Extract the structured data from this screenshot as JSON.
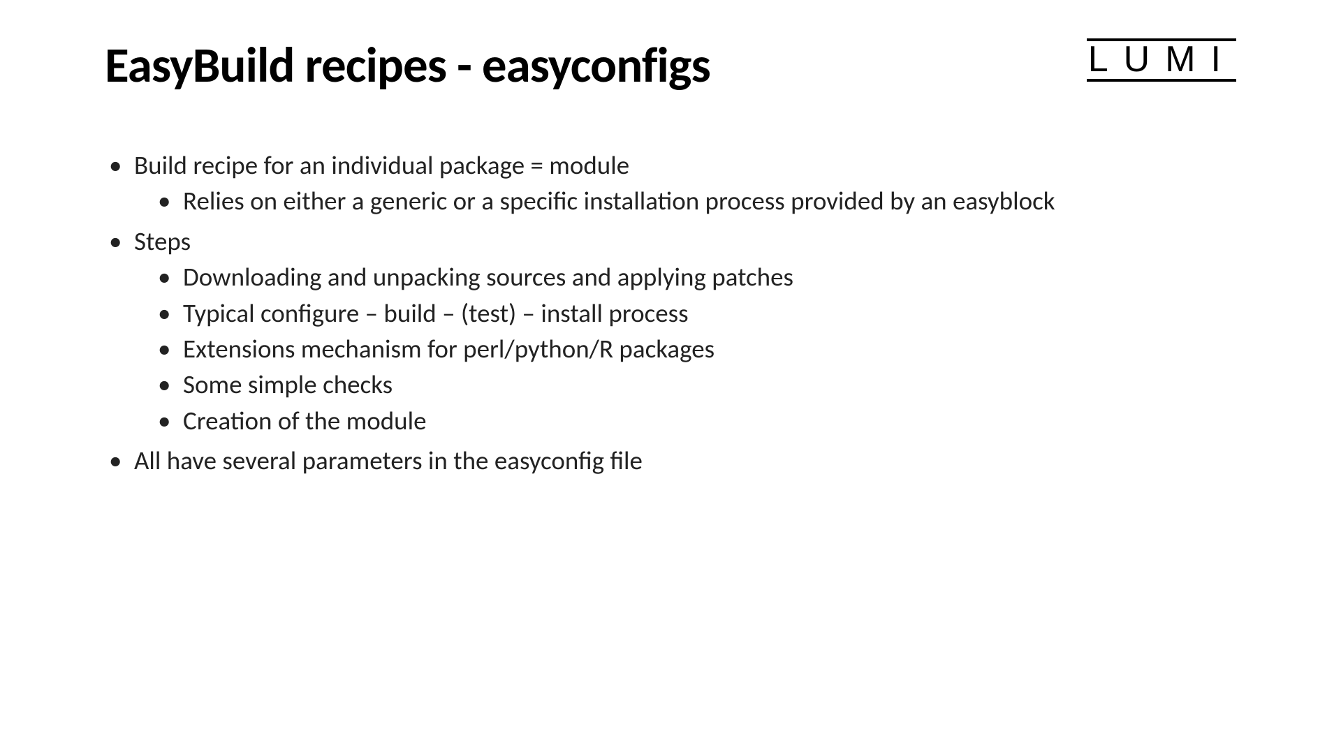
{
  "header": {
    "title": "EasyBuild recipes - easyconfigs",
    "logo": "LUMI"
  },
  "bullets": [
    {
      "text": "Build recipe for an individual package = module",
      "children": [
        "Relies on either a generic or a specific installation process provided by an easyblock"
      ]
    },
    {
      "text": "Steps",
      "children": [
        "Downloading and unpacking sources and applying patches",
        "Typical configure – build – (test) – install process",
        "Extensions mechanism for perl/python/R packages",
        "Some simple checks",
        "Creation of the module"
      ]
    },
    {
      "text": "All have several parameters in the easyconfig file",
      "children": []
    }
  ]
}
